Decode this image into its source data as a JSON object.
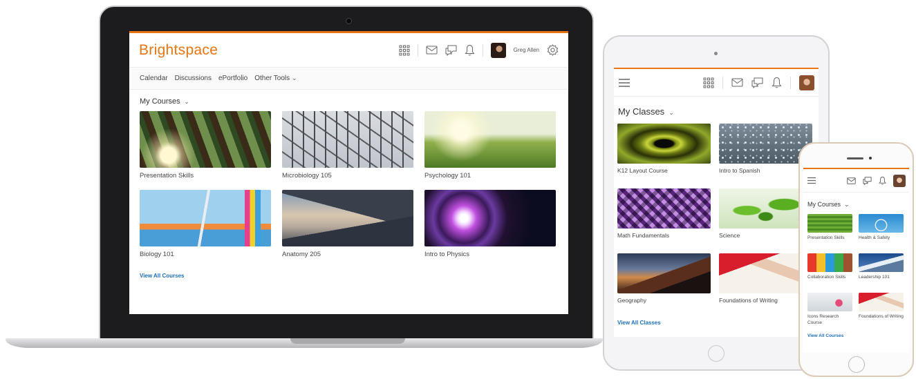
{
  "colors": {
    "brand_orange": "#e87511",
    "link_blue": "#1d6fb8"
  },
  "laptop": {
    "logo": "Brightspace",
    "user_name": "Greg Allen",
    "nav": [
      "Calendar",
      "Discussions",
      "ePortfolio",
      "Other Tools"
    ],
    "section_title": "My Courses",
    "courses": [
      {
        "name": "Presentation Skills",
        "image": "forest-canopy"
      },
      {
        "name": "Microbiology 105",
        "image": "roller-coaster"
      },
      {
        "name": "Psychology 101",
        "image": "sunny-meadow"
      },
      {
        "name": "Biology 101",
        "image": "lab-pipette"
      },
      {
        "name": "Anatomy 205",
        "image": "mountain-sky"
      },
      {
        "name": "Intro to Physics",
        "image": "light-tunnel"
      }
    ],
    "view_all": "View All Courses"
  },
  "tablet": {
    "section_title": "My Classes",
    "courses": [
      {
        "name": "K12 Layout Course",
        "image": "eye-closeup"
      },
      {
        "name": "Intro to Spanish",
        "image": "water-droplets"
      },
      {
        "name": "Math Fundamentals",
        "image": "purple-lattice"
      },
      {
        "name": "Science",
        "image": "sprouts"
      },
      {
        "name": "Geography",
        "image": "mountain-dusk"
      },
      {
        "name": "Foundations of Writing",
        "image": "writing-hand"
      }
    ],
    "view_all": "View All Classes"
  },
  "phone": {
    "section_title": "My Courses",
    "courses": [
      {
        "name": "Presentation Skills",
        "image": "green-field"
      },
      {
        "name": "Health & Safety",
        "image": "ferris-wheel"
      },
      {
        "name": "Collaboration Skills",
        "image": "craft-supplies"
      },
      {
        "name": "Leadership 101",
        "image": "snowy-peaks"
      },
      {
        "name": "Icons Research Course",
        "image": "sketch-hearts"
      },
      {
        "name": "Foundations of Writing",
        "image": "writing-hand"
      }
    ],
    "view_all": "View All Courses"
  }
}
